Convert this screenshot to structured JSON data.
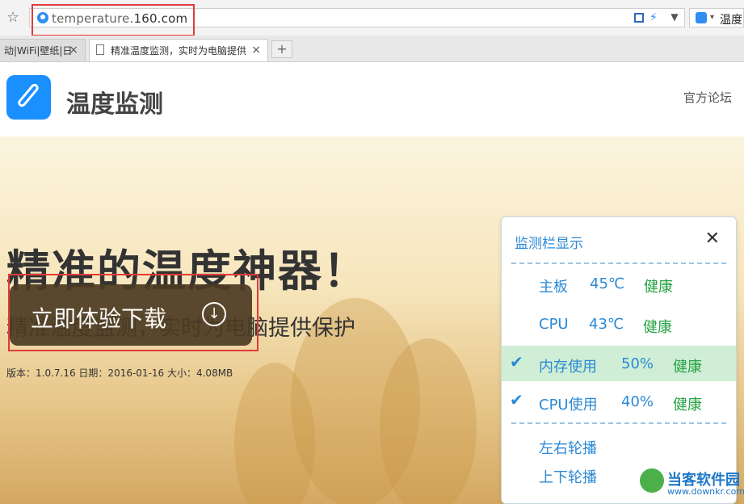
{
  "browser": {
    "url_prefix": "temperature.",
    "url_domain": "160.com",
    "search_text": "温度"
  },
  "tabs": [
    {
      "label": "动|WiFi|壁纸|日",
      "active": false
    },
    {
      "label": "精准温度监测，实时为电脑提供",
      "active": true
    }
  ],
  "site": {
    "brand": "温度监测",
    "forum_link": "官方论坛"
  },
  "hero": {
    "headline": "精准的温度神器！",
    "subheadline": "精准温度监测，实时为电脑提供保护",
    "meta": "版本：1.0.7.16 日期：2016-01-16 大小：4.08MB",
    "download_label": "立即体验下载"
  },
  "panel": {
    "title": "监测栏显示",
    "rows": [
      {
        "name": "主板",
        "value": "45℃",
        "status": "健康",
        "checked": false
      },
      {
        "name": "CPU",
        "value": "43℃",
        "status": "健康",
        "checked": false
      },
      {
        "name": "内存使用",
        "value": "50%",
        "status": "健康",
        "checked": true
      },
      {
        "name": "CPU使用",
        "value": "40%",
        "status": "健康",
        "checked": true
      }
    ],
    "options": [
      "左右轮播",
      "上下轮播"
    ]
  },
  "watermark": {
    "name": "当客软件园",
    "url": "www.downkr.com"
  },
  "colors": {
    "accent": "#2b89d6",
    "healthy": "#25a243",
    "highlight": "#e03b3b"
  }
}
